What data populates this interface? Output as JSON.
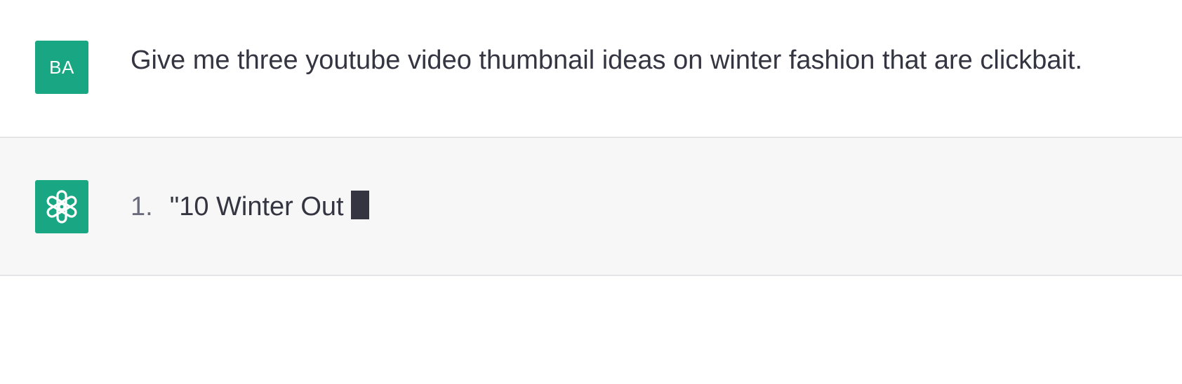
{
  "conversation": {
    "user_message": {
      "avatar_initials": "BA",
      "text": "Give me three youtube video thumbnail ideas on winter fashion that are clickbait."
    },
    "assistant_message": {
      "avatar_icon": "openai-logo-icon",
      "list_index": "1.",
      "text": "\"10 Winter Out"
    }
  },
  "colors": {
    "avatar_bg": "#19a683",
    "assistant_row_bg": "#f7f7f8",
    "text": "#343541"
  }
}
